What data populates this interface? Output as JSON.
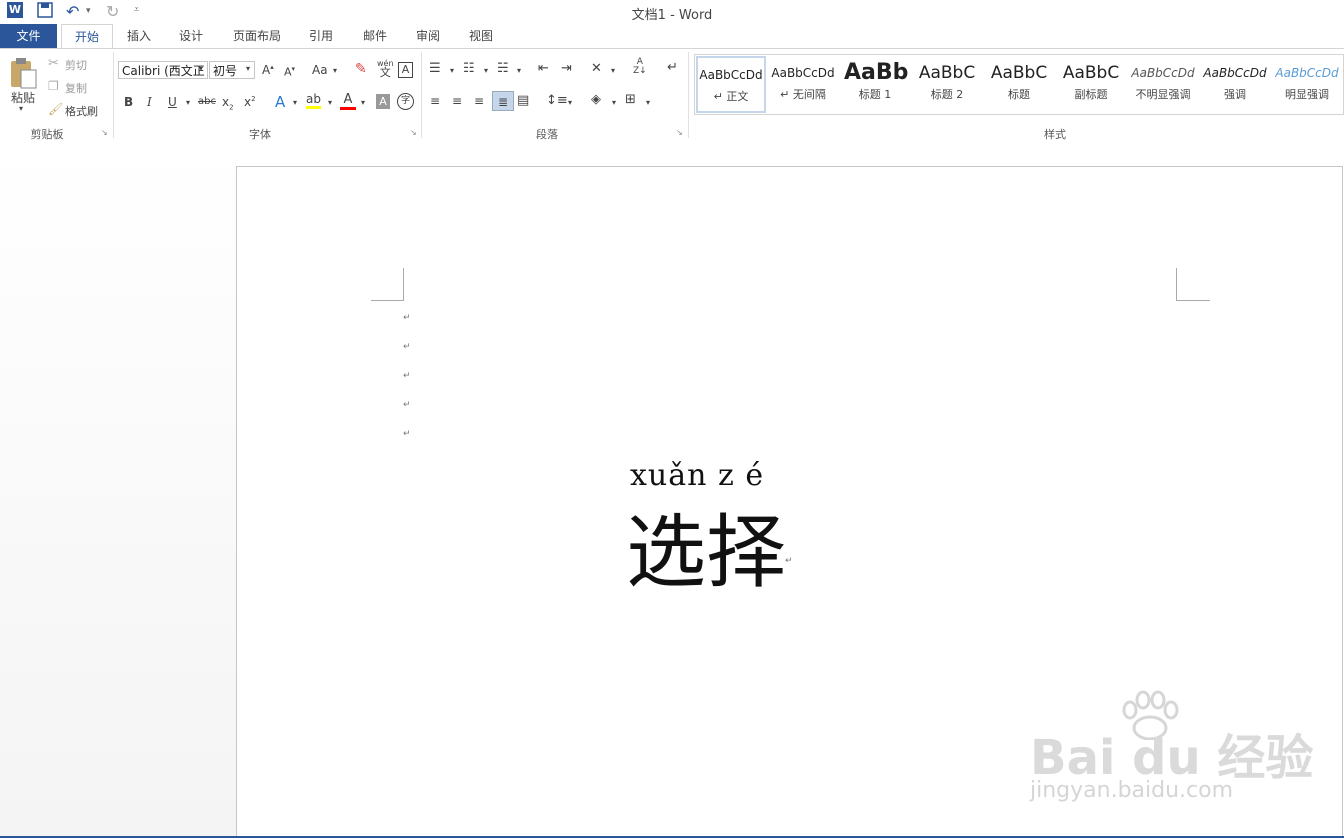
{
  "window": {
    "title": "文档1 - Word"
  },
  "qat": {
    "word_icon": "word-app-icon",
    "save_icon": "save-icon",
    "undo_icon": "undo-icon",
    "redo_icon": "redo-icon",
    "customize_icon": "customize-qat-icon"
  },
  "tabs": [
    {
      "label": "文件"
    },
    {
      "label": "开始"
    },
    {
      "label": "插入"
    },
    {
      "label": "设计"
    },
    {
      "label": "页面布局"
    },
    {
      "label": "引用"
    },
    {
      "label": "邮件"
    },
    {
      "label": "审阅"
    },
    {
      "label": "视图"
    }
  ],
  "clipboard": {
    "paste": "粘贴",
    "cut": "剪切",
    "copy": "复制",
    "format_painter": "格式刷",
    "group": "剪贴板"
  },
  "font": {
    "name": "Calibri (西文正",
    "size": "初号",
    "group": "字体",
    "change_case": "Aa",
    "phonetic_top": "wén",
    "phonetic_bottom": "文"
  },
  "paragraph": {
    "group": "段落"
  },
  "styles": {
    "group": "样式",
    "items": [
      {
        "sample": "AaBbCcDd",
        "name": "↵ 正文"
      },
      {
        "sample": "AaBbCcDd",
        "name": "↵ 无间隔"
      },
      {
        "sample": "AaBb",
        "name": "标题 1"
      },
      {
        "sample": "AaBbC",
        "name": "标题 2"
      },
      {
        "sample": "AaBbC",
        "name": "标题"
      },
      {
        "sample": "AaBbC",
        "name": "副标题"
      },
      {
        "sample": "AaBbCcDd",
        "name": "不明显强调"
      },
      {
        "sample": "AaBbCcDd",
        "name": "强调"
      },
      {
        "sample": "AaBbCcDd",
        "name": "明显强调"
      }
    ]
  },
  "document": {
    "paragraph_marks": [
      "↵",
      "↵",
      "↵",
      "↵",
      "↵"
    ],
    "pinyin": "xuǎn z é",
    "hanzi": "选择",
    "end_mark": "↵"
  },
  "watermark": {
    "brand": "Bai du 经验",
    "url": "jingyan.baidu.com"
  },
  "colors": {
    "accent": "#2b579a",
    "highlight": "#ffff00",
    "font_color": "#ff0000"
  }
}
